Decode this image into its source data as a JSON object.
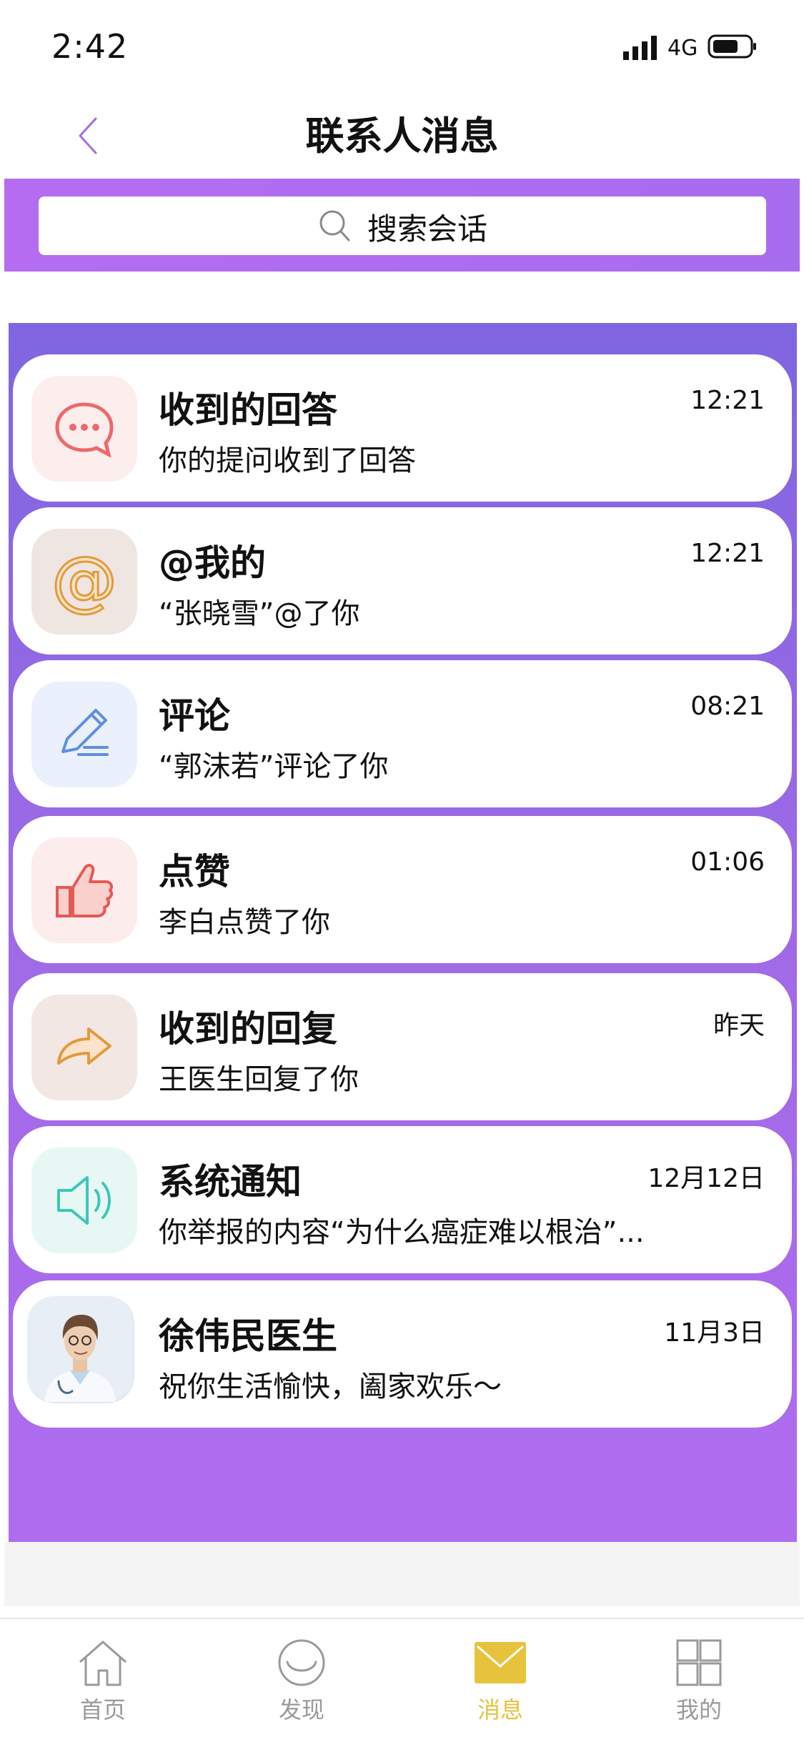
{
  "status_bar": {
    "time": "2:42",
    "network": "4G"
  },
  "nav": {
    "title": "联系人消息"
  },
  "search": {
    "placeholder": "搜索会话"
  },
  "messages": [
    {
      "title": "收到的回答",
      "subtitle": "你的提问收到了回答",
      "time": "12:21",
      "icon": "chat-bubble-icon"
    },
    {
      "title": "@我的",
      "subtitle": "“张晓雪”@了你",
      "time": "12:21",
      "icon": "at-sign-icon"
    },
    {
      "title": "评论",
      "subtitle": "“郭沫若”评论了你",
      "time": "08:21",
      "icon": "pencil-icon"
    },
    {
      "title": "点赞",
      "subtitle": "李白点赞了你",
      "time": "01:06",
      "icon": "thumbs-up-icon"
    },
    {
      "title": "收到的回复",
      "subtitle": "王医生回复了你",
      "time": "昨天",
      "icon": "reply-arrow-icon"
    },
    {
      "title": "系统通知",
      "subtitle": "你举报的内容“为什么癌症难以根治”...",
      "time": "12月12日",
      "icon": "speaker-icon"
    },
    {
      "title": "徐伟民医生",
      "subtitle": "祝你生活愉快，阖家欢乐～",
      "time": "11月3日",
      "icon": "doctor-avatar"
    }
  ],
  "tabs": [
    {
      "label": "首页",
      "icon": "home-icon",
      "active": false
    },
    {
      "label": "发现",
      "icon": "discover-icon",
      "active": false
    },
    {
      "label": "消息",
      "icon": "mail-icon",
      "active": true
    },
    {
      "label": "我的",
      "icon": "grid-icon",
      "active": false
    }
  ],
  "colors": {
    "accent": "#e7c23d",
    "band": "#b06cef",
    "back_arrow": "#a56be0"
  }
}
